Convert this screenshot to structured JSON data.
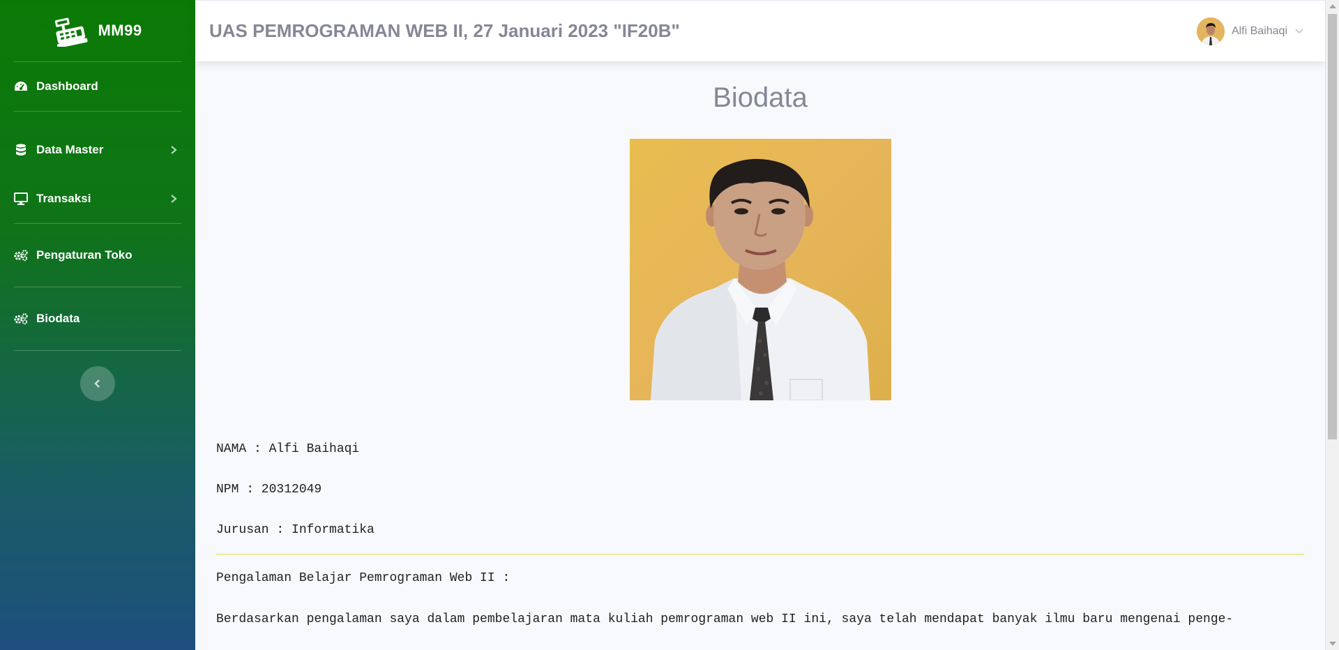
{
  "sidebar": {
    "brand": "MM99",
    "items": [
      {
        "label": "Dashboard",
        "icon": "tachometer-icon"
      },
      {
        "label": "Data Master",
        "icon": "database-icon",
        "has_submenu": true
      },
      {
        "label": "Transaksi",
        "icon": "desktop-icon",
        "has_submenu": true
      },
      {
        "label": "Pengaturan Toko",
        "icon": "cogs-icon"
      },
      {
        "label": "Biodata",
        "icon": "cogs-icon"
      }
    ]
  },
  "topbar": {
    "title": "UAS PEMROGRAMAN WEB II, 27 Januari 2023 \"IF20B\"",
    "user_name": "Alfi Baihaqi"
  },
  "main": {
    "title": "Biodata",
    "nama": "NAMA : Alfi Baihaqi",
    "npm": "NPM : 20312049",
    "jurusan": "Jurusan : Informatika",
    "experience_heading": "Pengalaman Belajar Pemrograman Web II :",
    "experience_text": "Berdasarkan pengalaman saya dalam pembelajaran mata kuliah pemrograman web II ini, saya telah mendapat banyak ilmu baru mengenai penge-"
  },
  "colors": {
    "sidebar_top": "#0b7a05",
    "sidebar_bottom": "#1e4f7e",
    "text_muted": "#858796",
    "divider_accent": "#e4e23a"
  }
}
